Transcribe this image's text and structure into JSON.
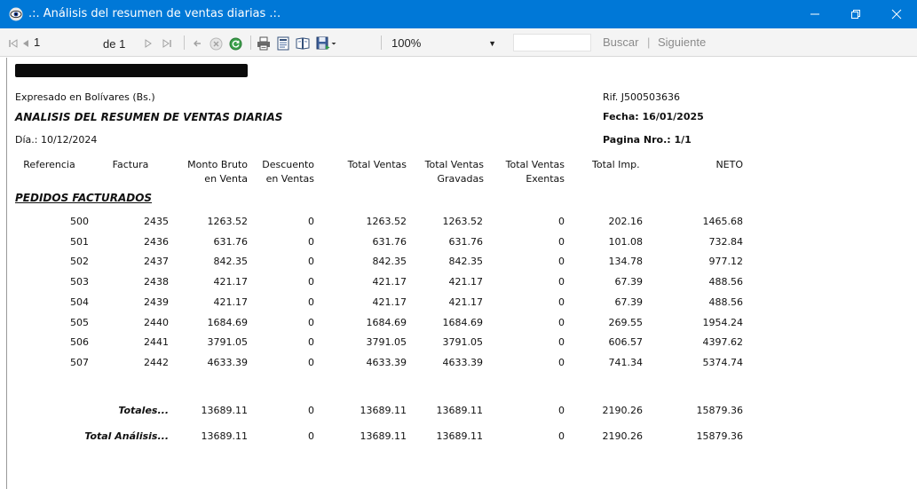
{
  "window": {
    "title": ".:. Análisis del resumen de ventas diarias .:.",
    "accent": "#0078d7"
  },
  "toolbar": {
    "page_current": "1",
    "page_of": "de 1",
    "zoom": "100%",
    "search_label": "Buscar",
    "next_label": "Siguiente",
    "separator": "|"
  },
  "report": {
    "currency_note": "Expresado en Bolívares (Bs.)",
    "title": "ANALISIS DEL RESUMEN DE VENTAS DIARIAS",
    "day": "Día.: 10/12/2024",
    "rif": "Rif. J500503636",
    "fecha": "Fecha: 16/01/2025",
    "pagina": "Pagina Nro.: 1/1",
    "section": "PEDIDOS FACTURADOS",
    "headers": {
      "referencia": "Referencia",
      "factura": "Factura",
      "monto_bruto_1": "Monto Bruto",
      "monto_bruto_2": "en Venta",
      "descuento_1": "Descuento",
      "descuento_2": "en Ventas",
      "total_ventas": "Total Ventas",
      "gravadas_1": "Total Ventas",
      "gravadas_2": "Gravadas",
      "exentas_1": "Total Ventas",
      "exentas_2": "Exentas",
      "total_imp": "Total Imp.",
      "neto": "NETO"
    },
    "rows": [
      [
        "500",
        "2435",
        "1263.52",
        "0",
        "1263.52",
        "1263.52",
        "0",
        "202.16",
        "1465.68"
      ],
      [
        "501",
        "2436",
        "631.76",
        "0",
        "631.76",
        "631.76",
        "0",
        "101.08",
        "732.84"
      ],
      [
        "502",
        "2437",
        "842.35",
        "0",
        "842.35",
        "842.35",
        "0",
        "134.78",
        "977.12"
      ],
      [
        "503",
        "2438",
        "421.17",
        "0",
        "421.17",
        "421.17",
        "0",
        "67.39",
        "488.56"
      ],
      [
        "504",
        "2439",
        "421.17",
        "0",
        "421.17",
        "421.17",
        "0",
        "67.39",
        "488.56"
      ],
      [
        "505",
        "2440",
        "1684.69",
        "0",
        "1684.69",
        "1684.69",
        "0",
        "269.55",
        "1954.24"
      ],
      [
        "506",
        "2441",
        "3791.05",
        "0",
        "3791.05",
        "3791.05",
        "0",
        "606.57",
        "4397.62"
      ],
      [
        "507",
        "2442",
        "4633.39",
        "0",
        "4633.39",
        "4633.39",
        "0",
        "741.34",
        "5374.74"
      ]
    ],
    "totales": {
      "label": "Totales...",
      "values": [
        "13689.11",
        "0",
        "13689.11",
        "13689.11",
        "0",
        "2190.26",
        "15879.36"
      ]
    },
    "total_analisis": {
      "label": "Total Análisis...",
      "values": [
        "13689.11",
        "0",
        "13689.11",
        "13689.11",
        "0",
        "2190.26",
        "15879.36"
      ]
    }
  }
}
